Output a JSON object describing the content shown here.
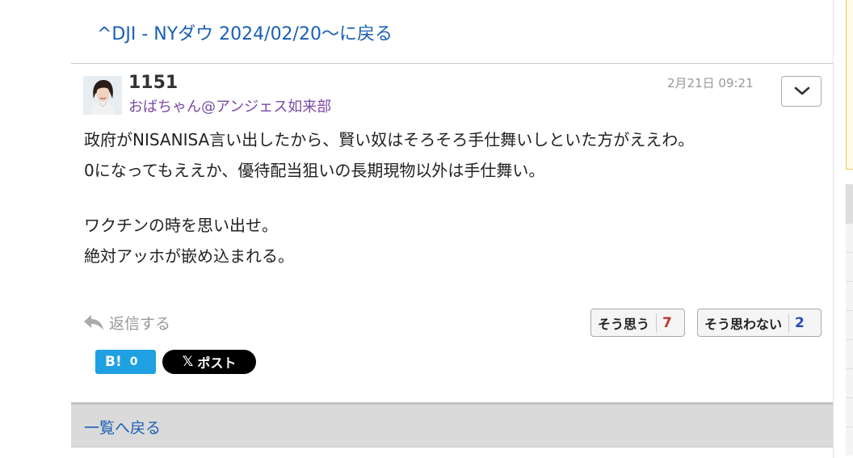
{
  "header": {
    "back_link": "^DJI - NYダウ 2024/02/20〜に戻る"
  },
  "post": {
    "user": "1151",
    "stock": "おばちゃん@アンジェス如来部",
    "timestamp": "2月21日 09:21",
    "lines": [
      "政府がNISANISA言い出したから、賢い奴はそろそろ手仕舞いしといた方がええわ。",
      "0になってもええか、優待配当狙いの長期現物以外は手仕舞い。",
      "",
      "ワクチンの時を思い出せ。",
      "絶対アッホが嵌め込まれる。"
    ]
  },
  "actions": {
    "reply_label": "返信する",
    "agree_label": "そう思う",
    "agree_count": "7",
    "disagree_label": "そう思わない",
    "disagree_count": "2",
    "hatena_label": "B!",
    "hatena_count": "0",
    "x_post_label": "ポスト"
  },
  "footer": {
    "back_to_list": "一覧へ戻る"
  },
  "colors": {
    "link": "#1a5fb4",
    "stock": "#7a4aa5",
    "agree": "#c0392b",
    "disagree": "#2b4bb8",
    "hatena": "#1fa0e3"
  }
}
